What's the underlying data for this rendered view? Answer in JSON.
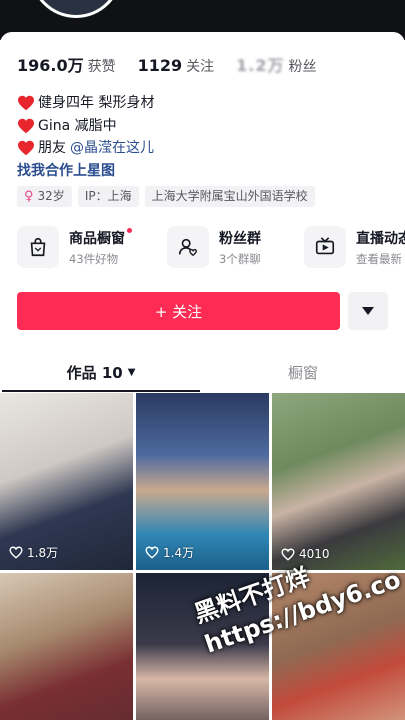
{
  "stats": {
    "likes_count": "196.0万",
    "likes_label": "获赞",
    "following_count": "1129",
    "following_label": "关注",
    "followers_count": "1.2万",
    "followers_label": "粉丝"
  },
  "bio": {
    "line1": "健身四年 梨形身材",
    "line2": "Gina  减脂中",
    "line3_prefix": "朋友",
    "line3_mention": "@晶滢在这儿",
    "link": "找我合作上星图"
  },
  "tags": {
    "age": "32岁",
    "ip": "IP：上海",
    "school": "上海大学附属宝山外国语学校"
  },
  "features": [
    {
      "title": "商品橱窗",
      "subtitle": "43件好物",
      "icon": "shopping-bag-icon"
    },
    {
      "title": "粉丝群",
      "subtitle": "3个群聊",
      "icon": "fan-group-icon"
    },
    {
      "title": "直播动态",
      "subtitle": "查看最新",
      "icon": "live-tv-icon"
    }
  ],
  "actions": {
    "follow_label": "+ 关注",
    "more_icon": "caret-down-icon"
  },
  "tabs": {
    "works": "作品 10",
    "shop": "橱窗"
  },
  "videos": [
    {
      "likes": "1.8万"
    },
    {
      "likes": "1.4万"
    },
    {
      "likes": "4010"
    },
    {
      "likes": ""
    },
    {
      "likes": ""
    },
    {
      "likes": ""
    }
  ],
  "watermark": {
    "line1": "黑料不打烊",
    "line2": "https://bdy6.co"
  },
  "colors": {
    "accent": "#fe2c55",
    "link": "#2b4d8f",
    "text": "#161823",
    "muted": "#8a8b91"
  }
}
